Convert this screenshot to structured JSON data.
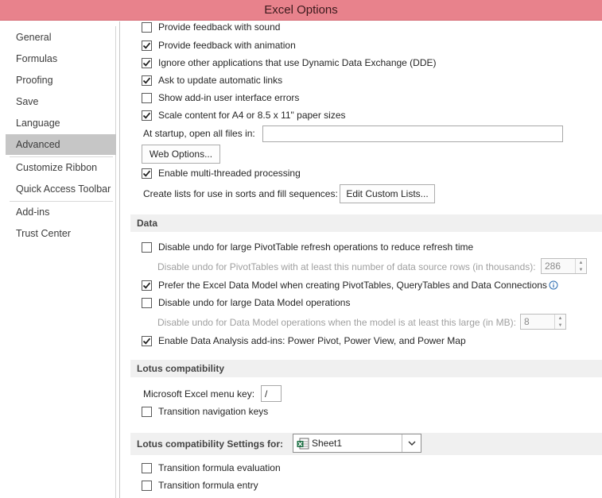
{
  "window": {
    "title": "Excel Options"
  },
  "sidebar": {
    "items": [
      {
        "label": "General"
      },
      {
        "label": "Formulas"
      },
      {
        "label": "Proofing"
      },
      {
        "label": "Save"
      },
      {
        "label": "Language"
      },
      {
        "label": "Advanced",
        "selected": true
      },
      {
        "label": "Customize Ribbon"
      },
      {
        "label": "Quick Access Toolbar"
      },
      {
        "label": "Add-ins"
      },
      {
        "label": "Trust Center"
      }
    ]
  },
  "general": {
    "feedback_sound": {
      "label": "Provide feedback with sound",
      "checked": false
    },
    "feedback_animation": {
      "label": "Provide feedback with animation",
      "checked": true
    },
    "ignore_dde": {
      "label": "Ignore other applications that use Dynamic Data Exchange (DDE)",
      "checked": true
    },
    "update_links": {
      "label": "Ask to update automatic links",
      "checked": true
    },
    "addin_errors": {
      "label": "Show add-in user interface errors",
      "checked": false
    },
    "scale_content": {
      "label": "Scale content for A4 or 8.5 x 11\" paper sizes",
      "checked": true
    },
    "startup_label": "At startup, open all files in:",
    "startup_value": "",
    "web_options_label": "Web Options...",
    "multithreaded": {
      "label": "Enable multi-threaded processing",
      "checked": true
    },
    "custom_lists_label": "Create lists for use in sorts and fill sequences:",
    "edit_custom_lists_label": "Edit Custom Lists..."
  },
  "data_section": {
    "title": "Data",
    "disable_undo_pivot": {
      "label": "Disable undo for large PivotTable refresh operations to reduce refresh time",
      "checked": false
    },
    "pivot_rows_label": "Disable undo for PivotTables with at least this number of data source rows (in thousands):",
    "pivot_rows_value": "286",
    "prefer_data_model": {
      "label": "Prefer the Excel Data Model when creating PivotTables, QueryTables and Data Connections",
      "checked": true
    },
    "info_icon": "info-icon",
    "disable_undo_model": {
      "label": "Disable undo for large Data Model operations",
      "checked": false
    },
    "model_size_label": "Disable undo for Data Model operations when the model is at least this large (in MB):",
    "model_size_value": "8",
    "analysis_addins": {
      "label": "Enable Data Analysis add-ins: Power Pivot, Power View, and Power Map",
      "checked": true
    }
  },
  "lotus": {
    "title": "Lotus compatibility",
    "menu_key_label": "Microsoft Excel menu key:",
    "menu_key_value": "/",
    "nav_keys": {
      "label": "Transition navigation keys",
      "checked": false
    }
  },
  "lotus_settings": {
    "title": "Lotus compatibility Settings for:",
    "sheet_value": "Sheet1",
    "formula_eval": {
      "label": "Transition formula evaluation",
      "checked": false
    },
    "formula_entry": {
      "label": "Transition formula entry",
      "checked": false
    }
  },
  "colors": {
    "titlebar": "#e8828c",
    "selected_nav": "#c6c6c6",
    "section_bg": "#f0f0f0"
  }
}
